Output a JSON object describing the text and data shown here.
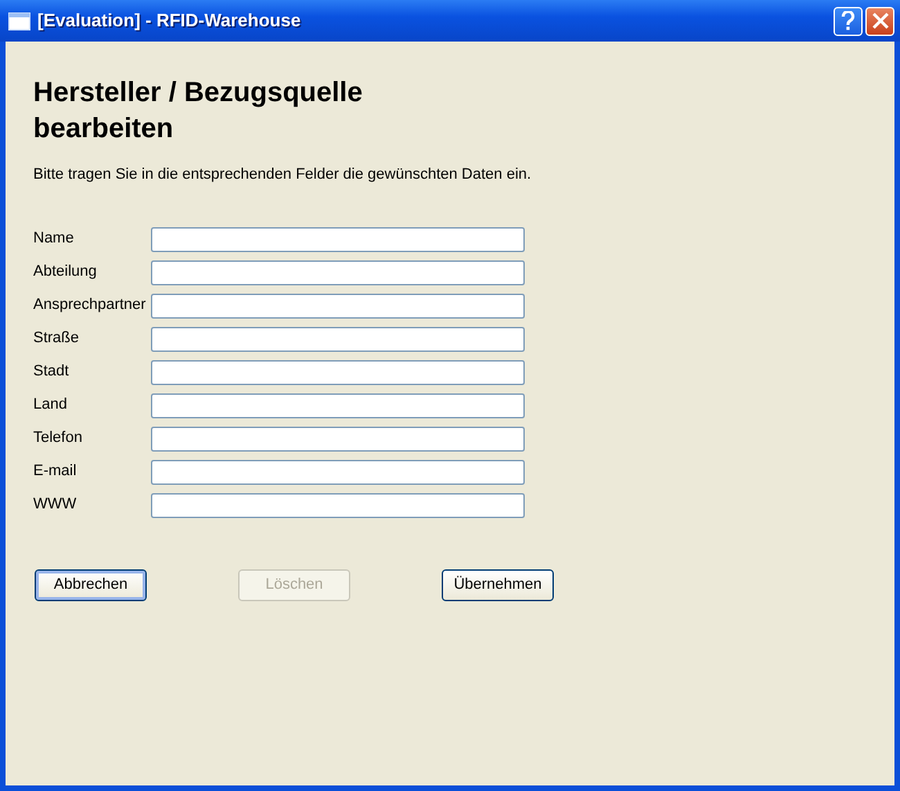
{
  "window": {
    "title": "[Evaluation] - RFID-Warehouse"
  },
  "heading": "Hersteller / Bezugsquelle bearbeiten",
  "instruction": "Bitte tragen Sie in die entsprechenden Felder die gewünschten Daten ein.",
  "fields": [
    {
      "label": "Name"
    },
    {
      "label": "Abteilung"
    },
    {
      "label": "Ansprechpartner"
    },
    {
      "label": "Straße"
    },
    {
      "label": "Stadt"
    },
    {
      "label": "Land"
    },
    {
      "label": "Telefon"
    },
    {
      "label": "E-mail"
    },
    {
      "label": "WWW"
    }
  ],
  "buttons": [
    {
      "label": "Abbrechen",
      "default": true,
      "disabled": false
    },
    {
      "label": "Löschen",
      "default": false,
      "disabled": true
    },
    {
      "label": "Übernehmen",
      "default": false,
      "disabled": false
    }
  ]
}
